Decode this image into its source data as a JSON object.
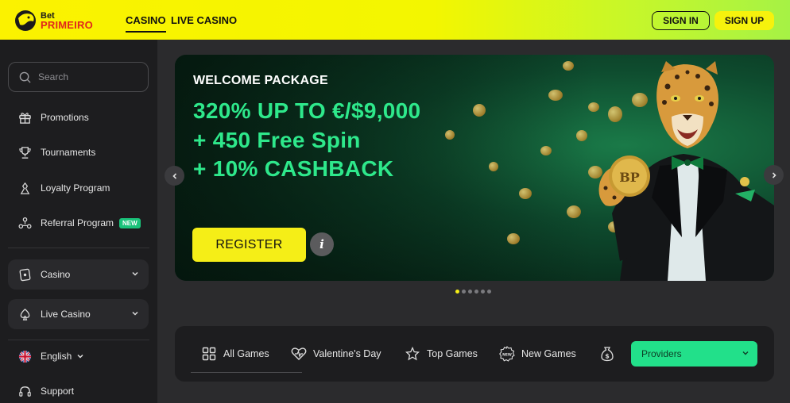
{
  "brand": {
    "line1": "Bet",
    "line2": "PRIMEIRO"
  },
  "header": {
    "nav": [
      {
        "label": "CASINO",
        "active": true
      },
      {
        "label": "LIVE CASINO",
        "active": false
      }
    ],
    "sign_in": "SIGN IN",
    "sign_up": "SIGN UP"
  },
  "sidebar": {
    "search_placeholder": "Search",
    "items": [
      {
        "label": "Promotions",
        "icon": "gift-icon"
      },
      {
        "label": "Tournaments",
        "icon": "trophy-icon"
      },
      {
        "label": "Loyalty Program",
        "icon": "loyalty-icon"
      },
      {
        "label": "Referral Program",
        "icon": "referral-icon",
        "badge": "NEW"
      }
    ],
    "groups": [
      {
        "label": "Casino",
        "icon": "casino-icon"
      },
      {
        "label": "Live Casino",
        "icon": "spade-icon"
      }
    ],
    "language": "English",
    "support": "Support"
  },
  "banner": {
    "kicker": "WELCOME PACKAGE",
    "lines": [
      "320% UP TO €/$9,000",
      "+ 450 Free Spin",
      "+ 10% CASHBACK"
    ],
    "register": "REGISTER",
    "info": "i",
    "coin_text": "BP",
    "slide_count": 6,
    "active_slide": 0
  },
  "tabs": [
    {
      "label": "All Games",
      "icon": "grid-icon"
    },
    {
      "label": "Valentine's Day",
      "icon": "heart-icon"
    },
    {
      "label": "Top Games",
      "icon": "star-icon"
    },
    {
      "label": "New Games",
      "icon": "new-icon"
    }
  ],
  "providers": "Providers",
  "colors": {
    "header_yellow": "#fbf200",
    "accent_green": "#2ee88b",
    "register_yellow": "#f5ee17",
    "badge_green": "#1ac37a"
  }
}
